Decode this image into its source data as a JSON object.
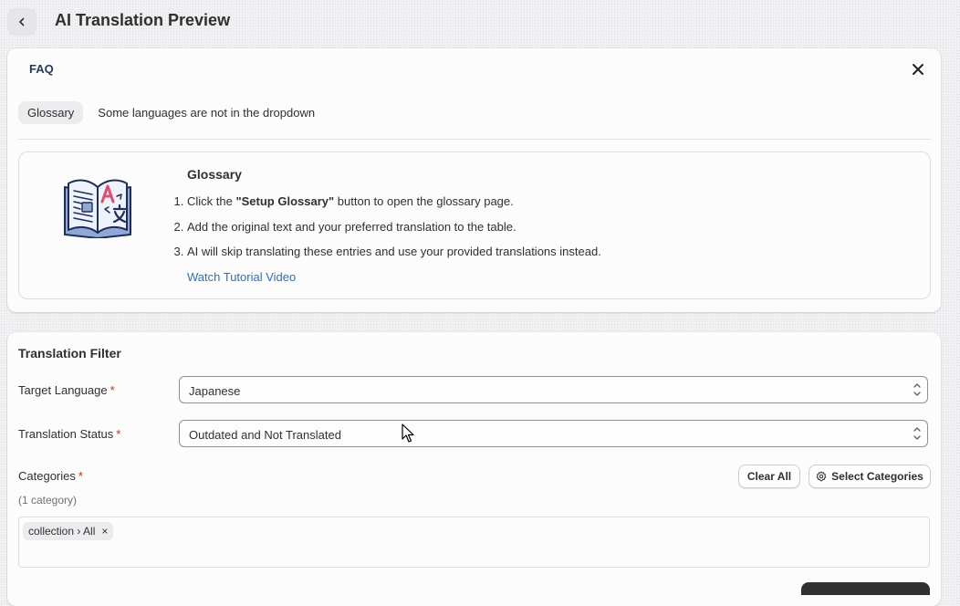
{
  "header": {
    "title": "AI Translation Preview",
    "back_icon": "chevron-left-icon"
  },
  "faq": {
    "title": "FAQ",
    "close_icon": "close-icon",
    "tabs": [
      {
        "label": "Glossary",
        "active": true
      },
      {
        "label": "Some languages are not in the dropdown",
        "active": false
      }
    ],
    "glossary": {
      "illustration": "open-book-translate-icon",
      "heading": "Glossary",
      "steps": [
        {
          "before": "Click the ",
          "bold": "\"Setup Glossary\"",
          "after": " button to open the glossary page."
        },
        {
          "text": "Add the original text and your preferred translation to the table."
        },
        {
          "text": "AI will skip translating these entries and use your provided translations instead."
        }
      ],
      "link": "Watch Tutorial Video"
    }
  },
  "filter": {
    "title": "Translation Filter",
    "required_mark": "*",
    "target_language": {
      "label": "Target Language",
      "value": "Japanese"
    },
    "translation_status": {
      "label": "Translation Status",
      "value": "Outdated and Not Translated"
    },
    "categories": {
      "label": "Categories",
      "count": "(1 category)",
      "clear_label": "Clear All",
      "select_label": "Select Categories",
      "select_icon": "gear-icon",
      "tags": [
        {
          "label": "collection › All",
          "remove": "×"
        }
      ]
    }
  },
  "colors": {
    "accent_link": "#2c6ecb",
    "required": "#d72c0d",
    "faq_title": "#1e3a5f",
    "dark_button": "#303030"
  }
}
